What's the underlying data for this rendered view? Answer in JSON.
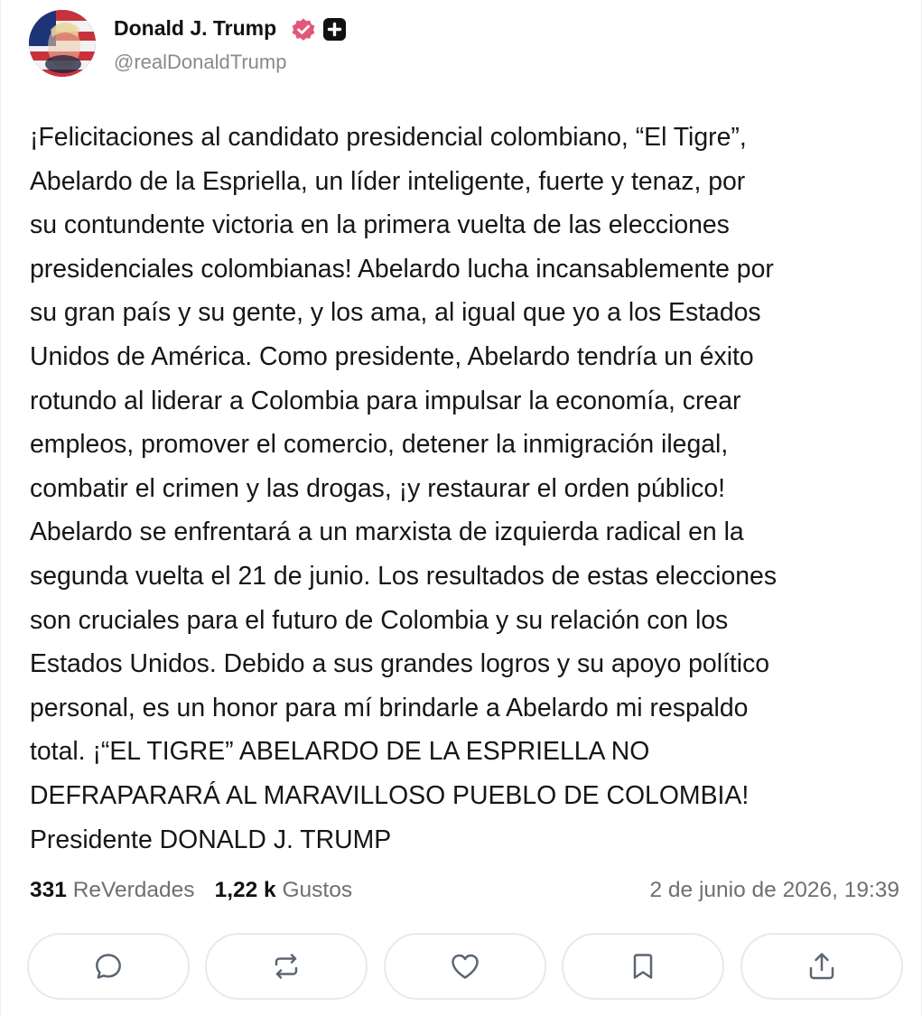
{
  "author": {
    "name": "Donald J. Trump",
    "handle": "@realDonaldTrump",
    "verified_icon": "verified-badge-icon",
    "plus_icon": "plus-badge-icon"
  },
  "post": {
    "text": "¡Felicitaciones al candidato presidencial colombiano, “El Tigre”,\nAbelardo de la Espriella, un líder inteligente, fuerte y tenaz, por\nsu contundente victoria en la primera vuelta de las elecciones\npresidenciales colombianas! Abelardo lucha incansablemente por\nsu gran país y su gente, y los ama, al igual que yo a los Estados\nUnidos de América. Como presidente, Abelardo tendría un éxito\nrotundo al liderar a Colombia para impulsar la economía, crear\nempleos, promover el comercio, detener la inmigración ilegal,\ncombatir el crimen y las drogas, ¡y restaurar el orden público!\nAbelardo se enfrentará a un marxista de izquierda radical en la\nsegunda vuelta el 21 de junio. Los resultados de estas elecciones\nson cruciales para el futuro de Colombia y su relación con los\nEstados Unidos. Debido a sus grandes logros y su apoyo político\npersonal, es un honor para mí brindarle a Abelardo mi respaldo\ntotal. ¡“EL TIGRE” ABELARDO DE LA ESPRIELLA NO\nDEFRAPARARÁ AL MARAVILLOSO PUEBLO DE COLOMBIA!\nPresidente DONALD J. TRUMP"
  },
  "stats": {
    "reposts_count": "331",
    "reposts_label": "ReVerdades",
    "likes_count": "1,22 k",
    "likes_label": "Gustos",
    "timestamp": "2 de junio de 2026, 19:39"
  },
  "actions": [
    {
      "icon": "reply-icon"
    },
    {
      "icon": "repost-icon"
    },
    {
      "icon": "like-icon"
    },
    {
      "icon": "bookmark-icon"
    },
    {
      "icon": "share-icon"
    }
  ],
  "colors": {
    "verified_badge": "#e2577a",
    "text": "#161616",
    "muted": "#6f6f6f",
    "border": "#e9e9e9"
  }
}
